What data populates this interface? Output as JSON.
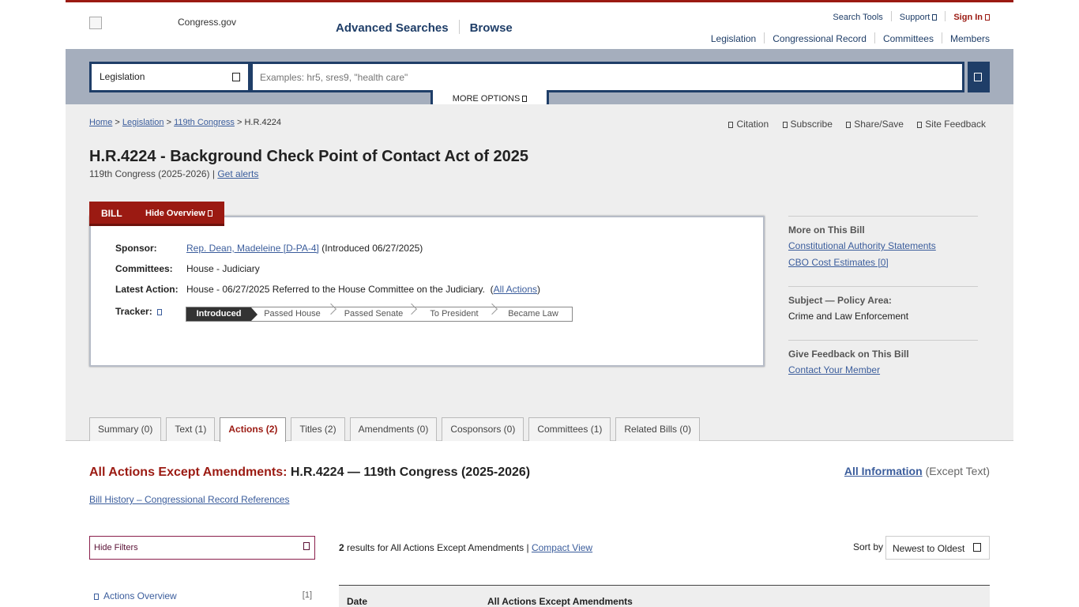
{
  "header": {
    "logo_text": "Congress.gov",
    "main_nav": [
      "Advanced Searches",
      "Browse"
    ],
    "utility": {
      "search_tools": "Search Tools",
      "support": "Support",
      "sign_in": "Sign In"
    },
    "sub_nav": [
      "Legislation",
      "Congressional Record",
      "Committees",
      "Members"
    ]
  },
  "search": {
    "collection": "Legislation",
    "placeholder": "Examples: hr5, sres9, \"health care\"",
    "more_options": "MORE OPTIONS"
  },
  "breadcrumb": {
    "home": "Home",
    "legislation": "Legislation",
    "congress": "119th Congress",
    "current": "H.R.4224",
    "sep": ">"
  },
  "page_actions": [
    "Citation",
    "Subscribe",
    "Share/Save",
    "Site Feedback"
  ],
  "bill": {
    "title": "H.R.4224 - Background Check Point of Contact Act of 2025",
    "congress": "119th Congress (2025-2026)",
    "get_alerts": "Get alerts",
    "tab_name": "BILL",
    "hide_overview": "Hide Overview",
    "sponsor_label": "Sponsor:",
    "sponsor": "Rep. Dean, Madeleine [D-PA-4]",
    "introduced": "(Introduced 06/27/2025)",
    "committees_label": "Committees:",
    "committees": "House - Judiciary",
    "latest_label": "Latest Action:",
    "latest": "House - 06/27/2025 Referred to the House Committee on the Judiciary.",
    "all_actions": "All Actions",
    "tracker_label": "Tracker:",
    "tracker_steps": [
      "Introduced",
      "Passed House",
      "Passed Senate",
      "To President",
      "Became Law"
    ]
  },
  "sidebar": {
    "more_head": "More on This Bill",
    "more_links": [
      "Constitutional Authority Statements",
      "CBO Cost Estimates [0]"
    ],
    "subject_head": "Subject — Policy Area:",
    "subject": "Crime and Law Enforcement",
    "feedback_head": "Give Feedback on This Bill",
    "feedback_link": "Contact Your Member"
  },
  "tabs": [
    "Summary (0)",
    "Text (1)",
    "Actions (2)",
    "Titles (2)",
    "Amendments (0)",
    "Cosponsors (0)",
    "Committees (1)",
    "Related Bills (0)"
  ],
  "actions_section": {
    "title_red": "All Actions Except Amendments:",
    "title_rest": "H.R.4224 — 119th Congress (2025-2026)",
    "all_info": "All Information",
    "except_text": "(Except Text)",
    "bill_history": "Bill History – Congressional Record References",
    "hide_filters": "Hide Filters",
    "results_count": "2",
    "results_text": "results for All Actions Except Amendments |",
    "compact_view": "Compact View",
    "sort_by": "Sort by",
    "sort_value": "Newest to Oldest",
    "filter_item": "Actions Overview",
    "filter_count": "[1]",
    "col_date": "Date",
    "col_actions": "All Actions Except Amendments"
  },
  "colors": {
    "brand_red": "#9b1a12",
    "navy": "#1f3e68",
    "link": "#3b5d9c"
  }
}
